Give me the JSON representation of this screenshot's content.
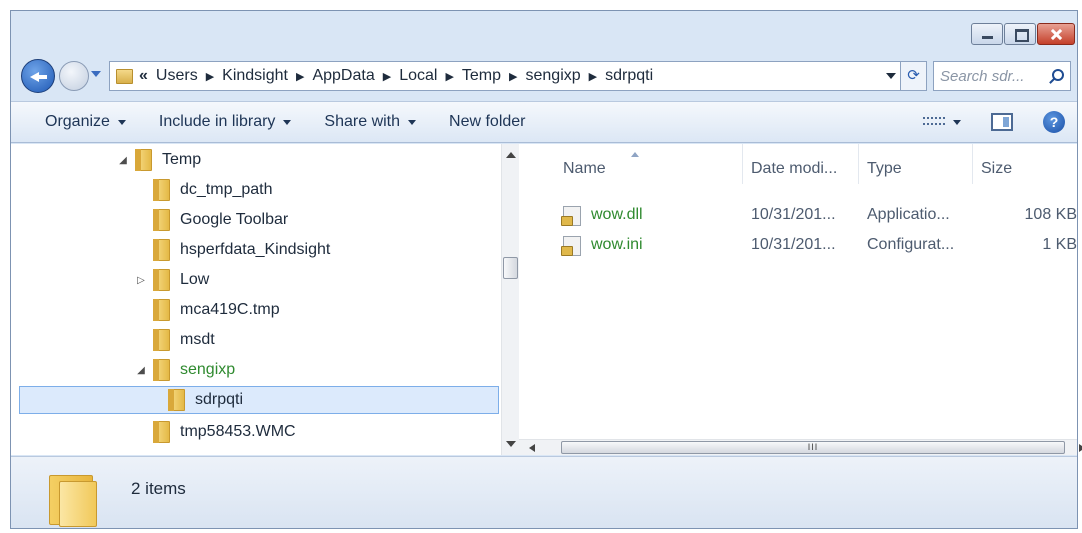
{
  "window": {
    "caption_buttons": [
      "minimize",
      "maximize",
      "close"
    ]
  },
  "address": {
    "overflow": "«",
    "crumbs": [
      "Users",
      "Kindsight",
      "AppData",
      "Local",
      "Temp",
      "sengixp",
      "sdrpqti"
    ]
  },
  "search": {
    "placeholder": "Search sdr..."
  },
  "toolbar": {
    "organize": "Organize",
    "include_in_library": "Include in library",
    "share_with": "Share with",
    "new_folder": "New folder",
    "help": "?"
  },
  "tree": {
    "items": [
      {
        "label": "Temp",
        "expander": "◢",
        "level": 0
      },
      {
        "label": "dc_tmp_path",
        "expander": "",
        "level": 1
      },
      {
        "label": "Google Toolbar",
        "expander": "",
        "level": 1
      },
      {
        "label": "hsperfdata_Kindsight",
        "expander": "",
        "level": 1
      },
      {
        "label": "Low",
        "expander": "▷",
        "level": 1
      },
      {
        "label": "mca419C.tmp",
        "expander": "",
        "level": 1
      },
      {
        "label": "msdt",
        "expander": "",
        "level": 1
      },
      {
        "label": "sengixp",
        "expander": "◢",
        "level": 1,
        "highlight": "green"
      },
      {
        "label": "sdrpqti",
        "expander": "",
        "level": 2,
        "selected": true
      },
      {
        "label": "tmp58453.WMC",
        "expander": "",
        "level": 1
      }
    ]
  },
  "columns": {
    "name": "Name",
    "date": "Date modi...",
    "type": "Type",
    "size": "Size"
  },
  "files": [
    {
      "name": "wow.dll",
      "date": "10/31/201...",
      "type": "Applicatio...",
      "size": "108 KB"
    },
    {
      "name": "wow.ini",
      "date": "10/31/201...",
      "type": "Configurat...",
      "size": "1 KB"
    }
  ],
  "hscroll": {
    "grip": "III"
  },
  "status": {
    "item_count": "2 items"
  },
  "colors": {
    "encrypted_green": "#2f8a2f",
    "selection": "#dceafc",
    "chrome": "#d9e6f5"
  }
}
